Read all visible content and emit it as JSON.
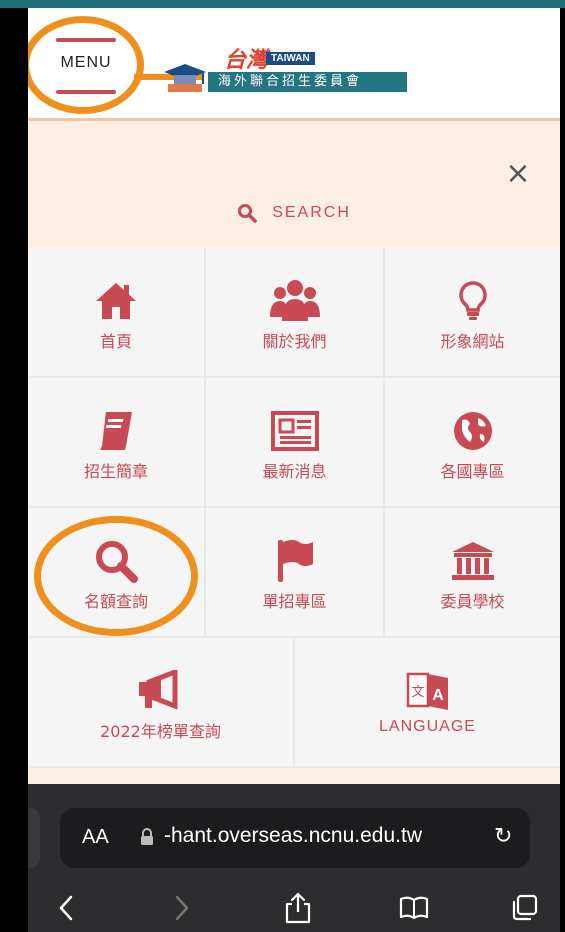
{
  "header": {
    "menu_label": "MENU",
    "logo_chars": "台灣",
    "logo_word": "TAIWAN",
    "org_name": "海外聯合招生委員會"
  },
  "search": {
    "label": "SEARCH",
    "close_glyph": "×"
  },
  "menu_items": [
    {
      "label": "首頁",
      "icon": "home-icon"
    },
    {
      "label": "關於我們",
      "icon": "group-icon"
    },
    {
      "label": "形象網站",
      "icon": "lightbulb-icon"
    },
    {
      "label": "招生簡章",
      "icon": "book-icon"
    },
    {
      "label": "最新消息",
      "icon": "newspaper-icon"
    },
    {
      "label": "各國專區",
      "icon": "globe-icon"
    },
    {
      "label": "名額查詢",
      "icon": "search-icon"
    },
    {
      "label": "單招專區",
      "icon": "flag-icon"
    },
    {
      "label": "委員學校",
      "icon": "institution-icon"
    },
    {
      "label": "2022年榜單查詢",
      "icon": "megaphone-icon"
    },
    {
      "label": "LANGUAGE",
      "icon": "translate-icon"
    }
  ],
  "browser": {
    "aa_label": "AA",
    "url": "-hant.overseas.ncnu.edu.tw",
    "reload_glyph": "↻"
  },
  "colors": {
    "accent": "#c84a55",
    "highlight_ring": "#f0901c",
    "panel_bg": "#fdeee4",
    "chrome_bg": "#2d2d2f"
  }
}
